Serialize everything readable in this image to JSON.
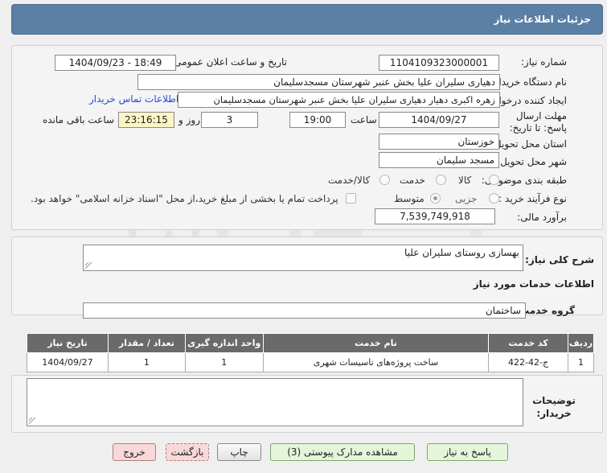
{
  "header": {
    "title": "جزئیات اطلاعات نیاز"
  },
  "form": {
    "need_number_label": "شماره نیاز:",
    "need_number": "1104109323000001",
    "announce_label": "تاریخ و ساعت اعلان عمومی:",
    "announce_value": "1404/09/23 - 18:49",
    "buyer_org_label": "نام دستگاه خریدار:",
    "buyer_org": "دهیاری سلیران علیا بخش عنبر شهرستان مسجدسلیمان",
    "creator_label": "ایجاد کننده درخواست:",
    "creator": "زهره اکبری دهیار دهیاری سلیران علیا بخش عنبر شهرستان مسجدسلیمان",
    "contact_link": "اطلاعات تماس خریدار",
    "deadline_label": "مهلت ارسال پاسخ: تا تاریخ:",
    "deadline_date": "1404/09/27",
    "time_label": "ساعت",
    "deadline_time": "19:00",
    "days_value": "3",
    "days_label": "روز و",
    "remaining_time": "23:16:15",
    "remaining_label": "ساعت باقی مانده",
    "province_label": "استان محل تحویل:",
    "province": "خوزستان",
    "city_label": "شهر محل تحویل:",
    "city": "مسجد سلیمان",
    "category_label": "طبقه بندی موضوعی:",
    "category_options": [
      "کالا",
      "خدمت",
      "کالا/خدمت"
    ],
    "process_label": "نوع فرآیند خرید :",
    "process_options": [
      "جزیی",
      "متوسط"
    ],
    "payment_note": "پرداخت تمام یا بخشی از مبلغ خرید،از محل \"اسناد خزانه اسلامی\" خواهد بود.",
    "estimate_label": "برآورد مالی:",
    "estimate": "7,539,749,918"
  },
  "description": {
    "label": "شرح کلی نیاز:",
    "value": "بهسازی روستای سلیران علیا"
  },
  "services": {
    "section_title": "اطلاعات خدمات مورد نیاز",
    "group_label": "گروه خدمت:",
    "group_value": "ساختمان",
    "columns": [
      "ردیف",
      "کد خدمت",
      "نام خدمت",
      "واحد اندازه گیری",
      "تعداد / مقدار",
      "تاریخ نیاز"
    ],
    "rows": [
      [
        "1",
        "ج-42-422",
        "ساخت پروژه‌های تاسیسات شهری",
        "1",
        "1",
        "1404/09/27"
      ]
    ]
  },
  "buyer_notes": {
    "label": "توضیحات خریدار:"
  },
  "buttons": {
    "reply": "پاسخ به نیاز",
    "view_docs": "مشاهده مدارک پیوستی (3)",
    "print": "چاپ",
    "back": "بازگشت",
    "exit": "خروج"
  },
  "colors": {
    "title_bar": "#5c7fa6",
    "table_header": "#6a6a6a",
    "link": "#1d4fd1",
    "remaining_bg": "#fbf6c3"
  }
}
